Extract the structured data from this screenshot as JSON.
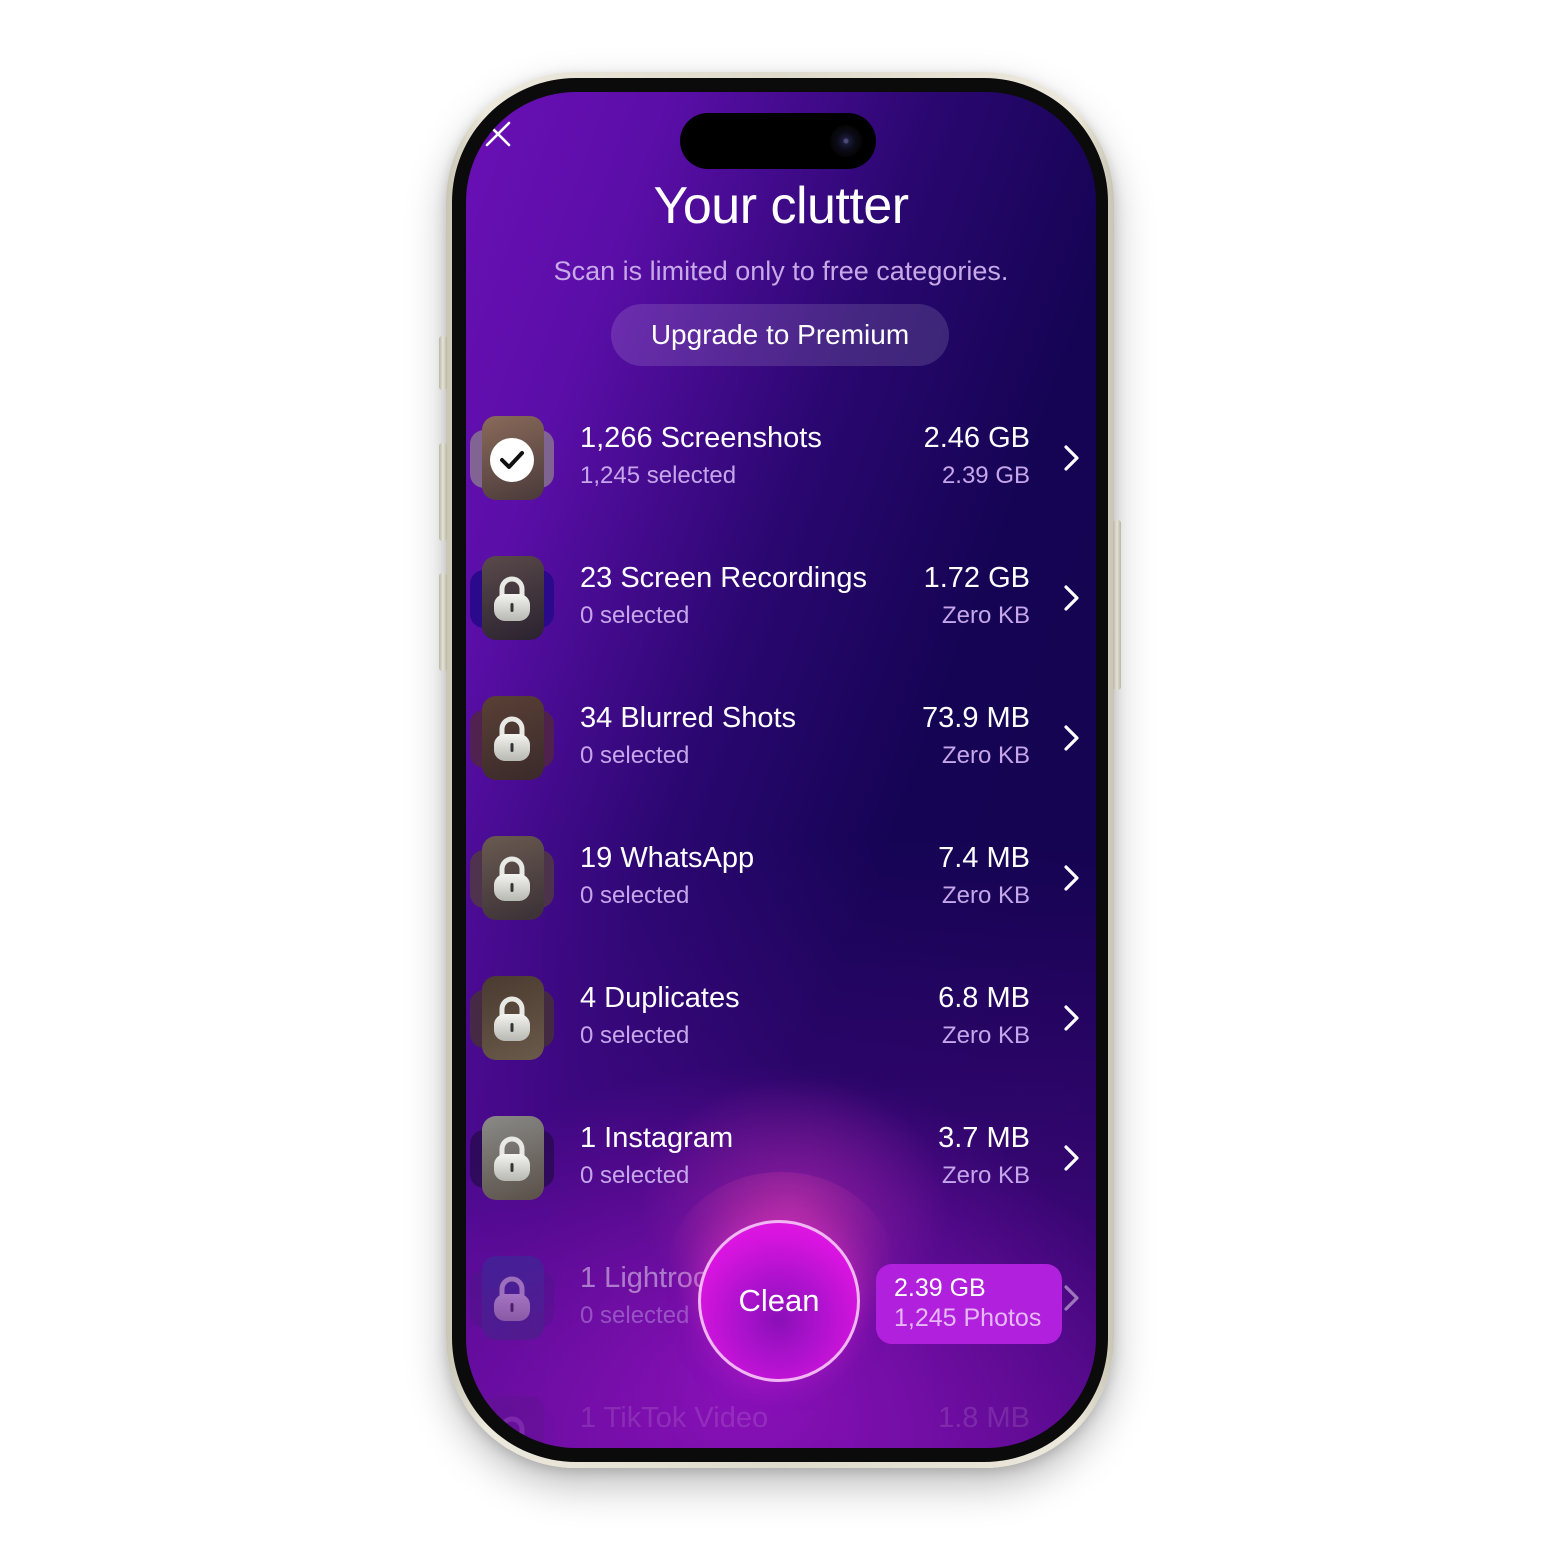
{
  "header": {
    "close_icon": "close-icon",
    "title": "Your clutter",
    "subtitle": "Scan is limited only to free categories.",
    "upgrade_label": "Upgrade to Premium"
  },
  "categories": [
    {
      "title": "1,266 Screenshots",
      "selected": "1,245 selected",
      "size": "2.46 GB",
      "selected_size": "2.39 GB",
      "locked": false,
      "checked": true
    },
    {
      "title": "23 Screen Recordings",
      "selected": "0 selected",
      "size": "1.72 GB",
      "selected_size": "Zero KB",
      "locked": true,
      "checked": false
    },
    {
      "title": "34 Blurred Shots",
      "selected": "0 selected",
      "size": "73.9 MB",
      "selected_size": "Zero KB",
      "locked": true,
      "checked": false
    },
    {
      "title": "19 WhatsApp",
      "selected": "0 selected",
      "size": "7.4 MB",
      "selected_size": "Zero KB",
      "locked": true,
      "checked": false
    },
    {
      "title": "4 Duplicates",
      "selected": "0 selected",
      "size": "6.8 MB",
      "selected_size": "Zero KB",
      "locked": true,
      "checked": false
    },
    {
      "title": "1 Instagram",
      "selected": "0 selected",
      "size": "3.7 MB",
      "selected_size": "Zero KB",
      "locked": true,
      "checked": false
    },
    {
      "title": "1 Lightroom",
      "selected": "0 selected",
      "size": "",
      "selected_size": "",
      "locked": true,
      "checked": false
    },
    {
      "title": "1 TikTok Video",
      "selected": "",
      "size": "1.8 MB",
      "selected_size": "",
      "locked": true,
      "checked": false
    }
  ],
  "footer": {
    "clean_label": "Clean",
    "summary_size": "2.39 GB",
    "summary_count": "1,245 Photos"
  },
  "colors": {
    "accent": "#d914e0",
    "badge": "#b020dd",
    "secondary_text": "#c6a6ea",
    "background_dark": "#13034d",
    "background_purple": "#6a0fb5"
  }
}
